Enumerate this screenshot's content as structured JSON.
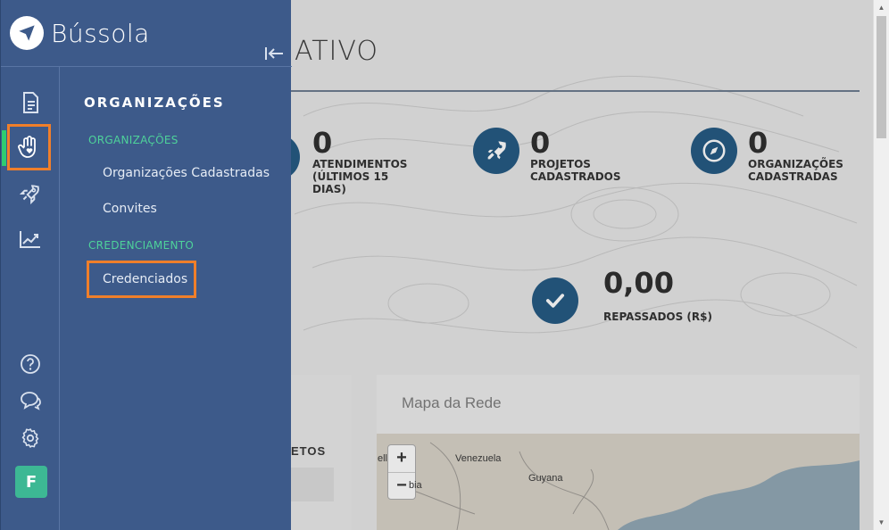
{
  "brand": {
    "name": "Bússola"
  },
  "page": {
    "title_fragment": "ATIVO"
  },
  "stats": [
    {
      "value": "0",
      "label": "ATENDIMENTOS (ÚLTIMOS 15 DIAS)",
      "icon": "partial-circle-icon"
    },
    {
      "value": "0",
      "label": "PROJETOS CADASTRADOS",
      "icon": "rocket-icon"
    },
    {
      "value": "0",
      "label": "ORGANIZAÇÕES CADASTRADAS",
      "icon": "compass-icon"
    },
    {
      "value": "0,00",
      "label": "REPASSADOS (R$)",
      "icon": "check-icon"
    }
  ],
  "panels": {
    "left_header_fragment": "ETOS",
    "map_title": "Mapa da Rede",
    "map_labels": [
      "ell",
      "Venezuela",
      "Guyana",
      "bia"
    ],
    "zoom_in": "+",
    "zoom_out": "−"
  },
  "sidebar": {
    "menu_title": "ORGANIZAÇÕES",
    "sections": [
      {
        "title": "ORGANIZAÇÕES",
        "items": [
          "Organizações Cadastradas",
          "Convites"
        ]
      },
      {
        "title": "CREDENCIAMENTO",
        "items": [
          "Credenciados"
        ]
      }
    ],
    "avatar_initial": "F"
  },
  "colors": {
    "sidebar_bg": "#3d5a8a",
    "accent_green": "#2ecc71",
    "section_green": "#4ed29a",
    "highlight_orange": "#f07f2a",
    "stat_icon_blue": "#1f5680"
  }
}
